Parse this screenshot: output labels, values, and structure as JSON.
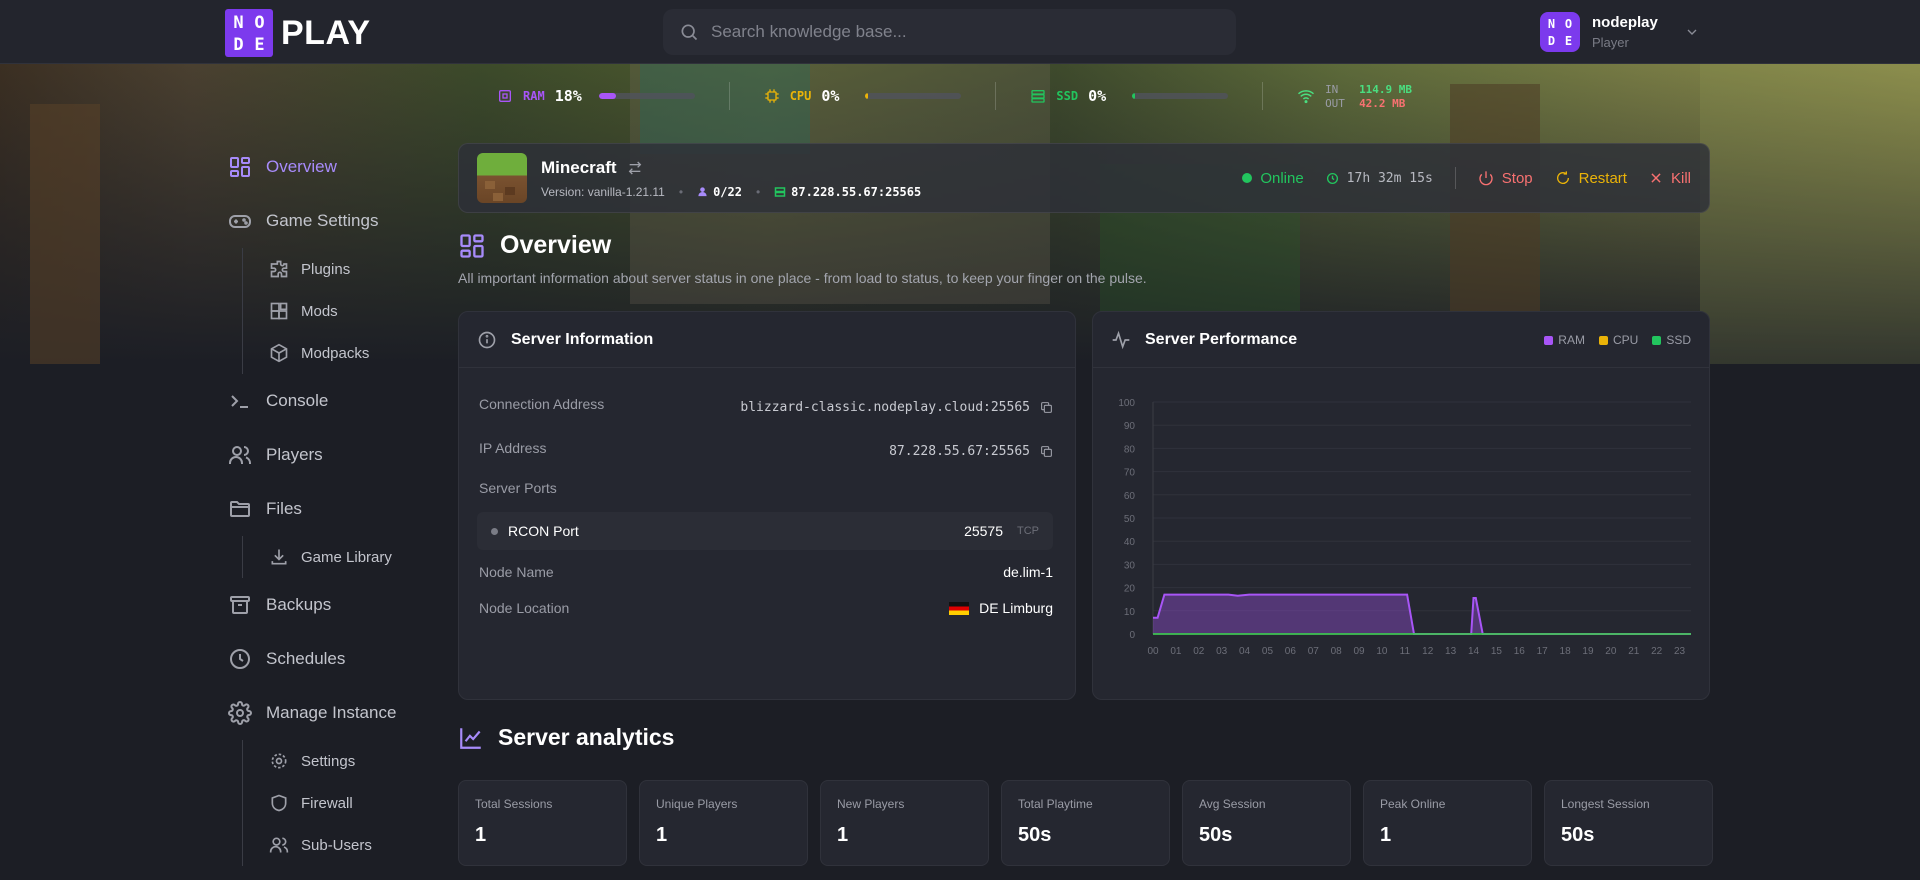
{
  "header": {
    "logo_text": "PLAY",
    "logo_letters": [
      "N",
      "O",
      "D",
      "E"
    ],
    "search_placeholder": "Search knowledge base...",
    "user_name": "nodeplay",
    "user_role": "Player"
  },
  "stats": {
    "ram": {
      "label": "RAM",
      "value": "18%",
      "percent": 18,
      "color": "#a855f7"
    },
    "cpu": {
      "label": "CPU",
      "value": "0%",
      "percent": 0,
      "color": "#eab308"
    },
    "ssd": {
      "label": "SSD",
      "value": "0%",
      "percent": 0,
      "color": "#22c55e"
    },
    "network": {
      "in_label": "IN",
      "in_value": "114.9 MB",
      "out_label": "OUT",
      "out_value": "42.2 MB",
      "in_color": "#4ade80",
      "out_color": "#f87171"
    }
  },
  "sidebar": {
    "overview": "Overview",
    "game_settings": "Game Settings",
    "plugins": "Plugins",
    "mods": "Mods",
    "modpacks": "Modpacks",
    "console": "Console",
    "players": "Players",
    "files": "Files",
    "game_library": "Game Library",
    "backups": "Backups",
    "schedules": "Schedules",
    "manage_instance": "Manage Instance",
    "settings": "Settings",
    "firewall": "Firewall",
    "sub_users": "Sub-Users"
  },
  "server": {
    "name": "Minecraft",
    "version": "Version: vanilla-1.21.11",
    "players": "0/22",
    "address": "87.228.55.67:25565",
    "status": "Online",
    "uptime": "17h 32m 15s",
    "stop": "Stop",
    "restart": "Restart",
    "kill": "Kill"
  },
  "page": {
    "title": "Overview",
    "description": "All important information about server status in one place - from load to status, to keep your finger on the pulse."
  },
  "server_info": {
    "title": "Server Information",
    "connection_label": "Connection Address",
    "connection_value": "blizzard-classic.nodeplay.cloud:25565",
    "ip_label": "IP Address",
    "ip_value": "87.228.55.67:25565",
    "ports_label": "Server Ports",
    "rcon_label": "RCON Port",
    "rcon_value": "25575",
    "rcon_proto": "TCP",
    "node_name_label": "Node Name",
    "node_name_value": "de.lim-1",
    "node_location_label": "Node Location",
    "node_location_value": "DE Limburg"
  },
  "performance": {
    "title": "Server Performance",
    "legend": [
      {
        "name": "RAM",
        "color": "#a855f7"
      },
      {
        "name": "CPU",
        "color": "#eab308"
      },
      {
        "name": "SSD",
        "color": "#22c55e"
      }
    ]
  },
  "chart_data": {
    "type": "area",
    "title": "Server Performance",
    "x": [
      0,
      0.2,
      0.5,
      3.3,
      3.7,
      4.2,
      11.1,
      11.4,
      13.9,
      14.0,
      14.1,
      14.4,
      14.5,
      23.5
    ],
    "categories": [
      "00",
      "01",
      "02",
      "03",
      "04",
      "05",
      "06",
      "07",
      "08",
      "09",
      "10",
      "11",
      "12",
      "13",
      "14",
      "15",
      "16",
      "17",
      "18",
      "19",
      "20",
      "21",
      "22",
      "23"
    ],
    "yticks": [
      0,
      10,
      20,
      30,
      40,
      50,
      60,
      70,
      80,
      90,
      100
    ],
    "ylim": [
      0,
      100
    ],
    "xlim": [
      0,
      23.5
    ],
    "grid": true,
    "legend": "top-right",
    "series": [
      {
        "name": "RAM",
        "color": "#a855f7",
        "values": [
          7,
          7,
          17,
          17,
          16.5,
          17,
          17,
          0,
          0,
          15.5,
          15.5,
          0,
          0,
          0
        ]
      },
      {
        "name": "CPU",
        "color": "#eab308",
        "values": [
          0,
          0,
          0,
          0,
          0,
          0,
          0,
          0,
          0,
          0,
          0,
          0,
          0,
          0
        ]
      },
      {
        "name": "SSD",
        "color": "#22c55e",
        "values": [
          0,
          0,
          0,
          0,
          0,
          0,
          0,
          0,
          0,
          0,
          0,
          0,
          0,
          0
        ]
      }
    ]
  },
  "analytics": {
    "title": "Server analytics",
    "cards": [
      {
        "label": "Total Sessions",
        "value": "1"
      },
      {
        "label": "Unique Players",
        "value": "1"
      },
      {
        "label": "New Players",
        "value": "1"
      },
      {
        "label": "Total Playtime",
        "value": "50s"
      },
      {
        "label": "Avg Session",
        "value": "50s"
      },
      {
        "label": "Peak Online",
        "value": "1"
      },
      {
        "label": "Longest Session",
        "value": "50s"
      }
    ]
  },
  "colors": {
    "accent": "#a78bfa",
    "online": "#22c55e",
    "stop": "#f87171",
    "restart": "#eab308",
    "kill": "#f87171"
  }
}
